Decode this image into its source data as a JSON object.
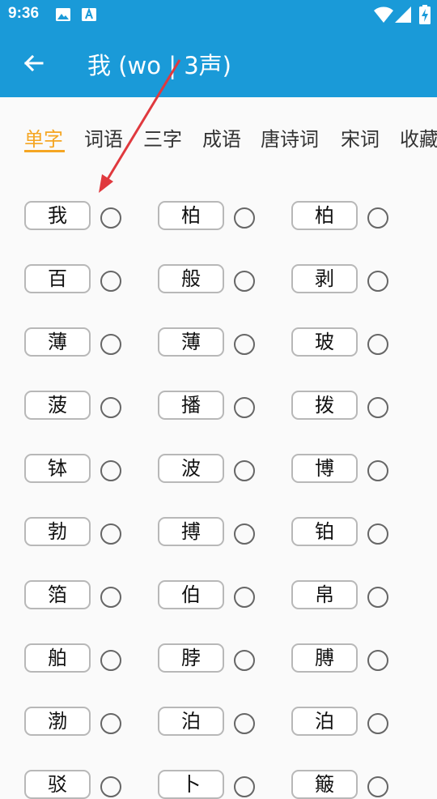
{
  "status_bar": {
    "time": "9:36",
    "icons": [
      "image-icon",
      "font-icon",
      "wifi-icon",
      "signal-icon",
      "battery-charging-icon"
    ]
  },
  "app_bar": {
    "title": "我 (wo | 3声)",
    "back_icon": "back-arrow-icon"
  },
  "tabs": [
    {
      "label": "单字",
      "active": true
    },
    {
      "label": "词语",
      "active": false
    },
    {
      "label": "三字",
      "active": false
    },
    {
      "label": "成语",
      "active": false
    },
    {
      "label": "唐诗词",
      "active": false
    },
    {
      "label": "宋词",
      "active": false
    },
    {
      "label": "收藏",
      "active": false
    }
  ],
  "characters": [
    "我",
    "柏",
    "柏",
    "百",
    "般",
    "剥",
    "薄",
    "薄",
    "玻",
    "菠",
    "播",
    "拨",
    "钵",
    "波",
    "博",
    "勃",
    "搏",
    "铂",
    "箔",
    "伯",
    "帛",
    "舶",
    "脖",
    "膊",
    "渤",
    "泊",
    "泊",
    "驳",
    "卜",
    "簸"
  ],
  "colors": {
    "primary": "#1a9ad8",
    "accent": "#f5a623",
    "annotation": "#e0393e"
  }
}
